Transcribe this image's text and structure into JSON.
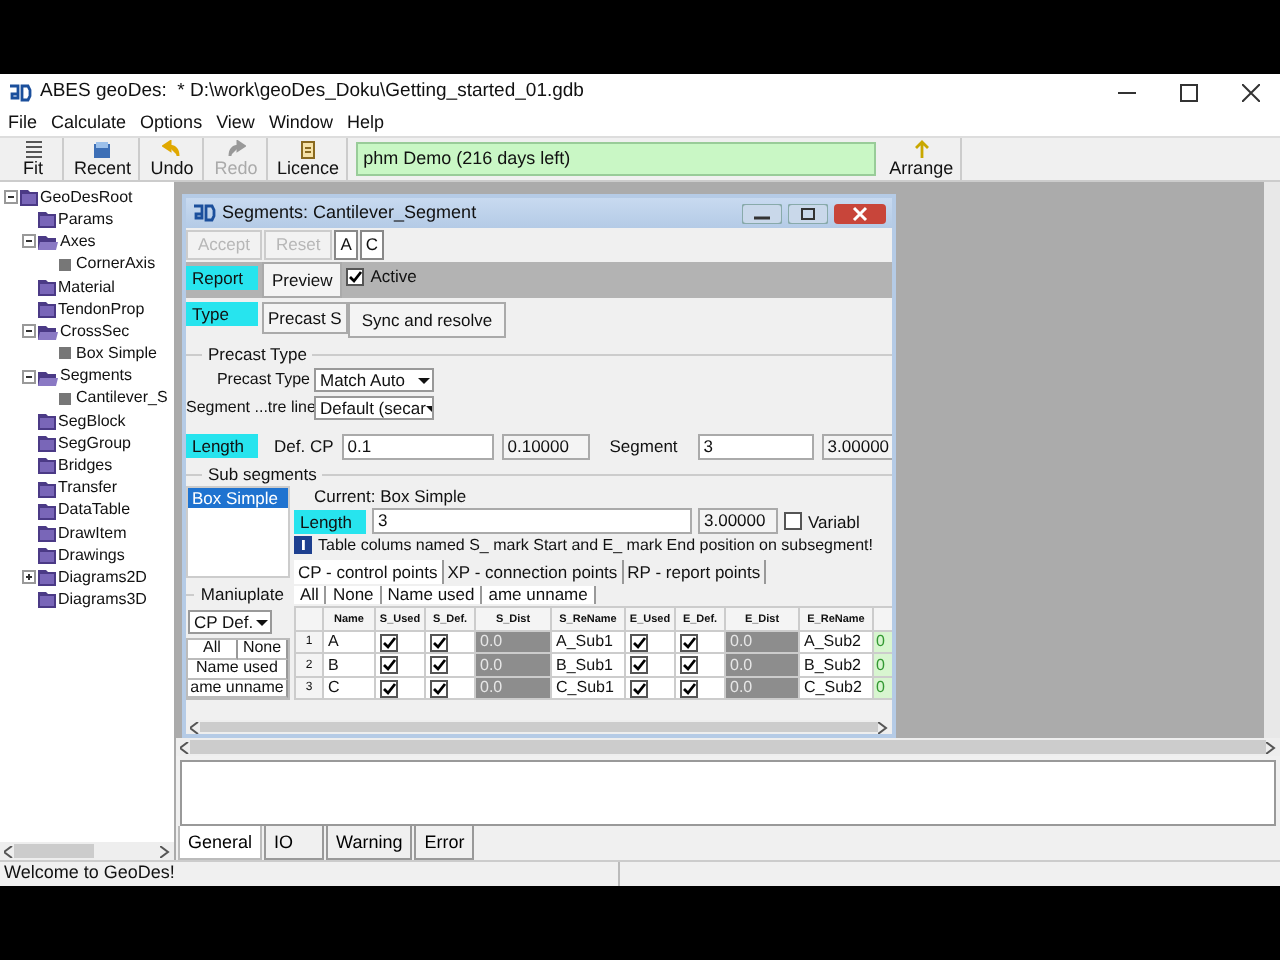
{
  "window": {
    "title": "ABES geoDes:  * D:\\work\\geoDes_Doku\\Getting_started_01.gdb"
  },
  "menu": [
    "File",
    "Calculate",
    "Options",
    "View",
    "Window",
    "Help"
  ],
  "toolbar": [
    {
      "label": "Fit",
      "disabled": false
    },
    {
      "label": "Recent",
      "disabled": false
    },
    {
      "label": "Undo",
      "disabled": false
    },
    {
      "label": "Redo",
      "disabled": true
    },
    {
      "label": "Licence",
      "disabled": false
    }
  ],
  "license_field": {
    "value": "phm Demo (216 days left)"
  },
  "arrange_button": {
    "label": "Arrange"
  },
  "tree": [
    {
      "label": "GeoDesRoot",
      "kind": "folder",
      "expanded": true,
      "children": [
        {
          "label": "Params",
          "kind": "folder"
        },
        {
          "label": "Axes",
          "kind": "open-folder",
          "expanded": true,
          "children": [
            {
              "label": "CornerAxis",
              "kind": "item"
            }
          ]
        },
        {
          "label": "Material",
          "kind": "folder"
        },
        {
          "label": "TendonProp",
          "kind": "folder"
        },
        {
          "label": "CrossSec",
          "kind": "open-folder",
          "expanded": true,
          "children": [
            {
              "label": "Box Simple",
              "kind": "item"
            }
          ]
        },
        {
          "label": "Segments",
          "kind": "open-folder",
          "expanded": true,
          "children": [
            {
              "label": "Cantilever_S",
              "kind": "item"
            }
          ]
        },
        {
          "label": "SegBlock",
          "kind": "folder"
        },
        {
          "label": "SegGroup",
          "kind": "folder"
        },
        {
          "label": "Bridges",
          "kind": "folder"
        },
        {
          "label": "Transfer",
          "kind": "folder"
        },
        {
          "label": "DataTable",
          "kind": "folder"
        },
        {
          "label": "DrawItem",
          "kind": "folder"
        },
        {
          "label": "Drawings",
          "kind": "folder"
        },
        {
          "label": "Diagrams2D",
          "kind": "folder",
          "expanded": false
        },
        {
          "label": "Diagrams3D",
          "kind": "folder"
        }
      ]
    }
  ],
  "segment_window": {
    "title": "Segments: Cantilever_Segment",
    "toolbar": [
      {
        "label": "Accept",
        "disabled": true
      },
      {
        "label": "Reset",
        "disabled": true
      },
      {
        "label": "A",
        "disabled": false
      },
      {
        "label": "C",
        "disabled": false
      }
    ],
    "report": {
      "label": "Report",
      "preview_button": "Preview",
      "active": {
        "label": "Active",
        "checked": true
      }
    },
    "type": {
      "label": "Type",
      "value": "Precast S",
      "sync_button": "Sync and resolve"
    },
    "precast_group": {
      "title": "Precast Type",
      "fields": [
        {
          "label": "Precast Type",
          "value": "Match Auto"
        },
        {
          "label": "Segment ...tre line",
          "value": "Default (secar"
        }
      ]
    },
    "length": {
      "label": "Length",
      "def_cp_label": "Def. CP",
      "def_cp_value": "0.1",
      "def_cp_result": "0.10000",
      "segment_label": "Segment",
      "segment_value": "3",
      "segment_result": "3.00000"
    },
    "sub_segments": {
      "title": "Sub segments",
      "list": [
        {
          "label": "Box Simple",
          "selected": true
        }
      ],
      "current": "Current: Box Simple",
      "length_label": "Length",
      "length_value": "3",
      "length_result": "3.00000",
      "variable": {
        "label": "Variabl",
        "checked": false
      },
      "note": "Table colums named S_ mark Start and E_ mark End position on subsegment!",
      "tabs": [
        {
          "label": "CP - control points",
          "selected": true
        },
        {
          "label": "XP - connection points",
          "selected": false
        },
        {
          "label": "RP - report points",
          "selected": false
        }
      ],
      "filter_buttons": [
        "All",
        "None",
        "Name used",
        "ame unname"
      ],
      "table": {
        "columns": [
          "Name",
          "S_Used",
          "S_Def.",
          "S_Dist",
          "S_ReName",
          "E_Used",
          "E_Def.",
          "E_Dist",
          "E_ReName"
        ],
        "rows": [
          {
            "number": "1",
            "name": "A",
            "s_used": true,
            "s_def": true,
            "s_dist": "0.0",
            "s_rename": "A_Sub1",
            "e_used": true,
            "e_def": true,
            "e_dist": "0.0",
            "e_rename": "A_Sub2",
            "column_11": "0"
          },
          {
            "number": "2",
            "name": "B",
            "s_used": true,
            "s_def": true,
            "s_dist": "0.0",
            "s_rename": "B_Sub1",
            "e_used": true,
            "e_def": true,
            "e_dist": "0.0",
            "e_rename": "B_Sub2",
            "column_11": "0"
          },
          {
            "number": "3",
            "name": "C",
            "s_used": true,
            "s_def": true,
            "s_dist": "0.0",
            "s_rename": "C_Sub1",
            "e_used": true,
            "e_def": true,
            "e_dist": "0.0",
            "e_rename": "C_Sub2",
            "column_11": "0"
          }
        ]
      }
    },
    "manipulate": {
      "title": "Maniuplate",
      "select": "CP Def.",
      "buttons": [
        "All",
        "None",
        "Name used",
        "ame unname"
      ]
    }
  },
  "output_tabs": [
    {
      "label": "General",
      "selected": true
    },
    {
      "label": "IO",
      "selected": false
    },
    {
      "label": "Warning",
      "selected": false
    },
    {
      "label": "Error",
      "selected": false
    }
  ],
  "status_bar": "Welcome to GeoDes!"
}
